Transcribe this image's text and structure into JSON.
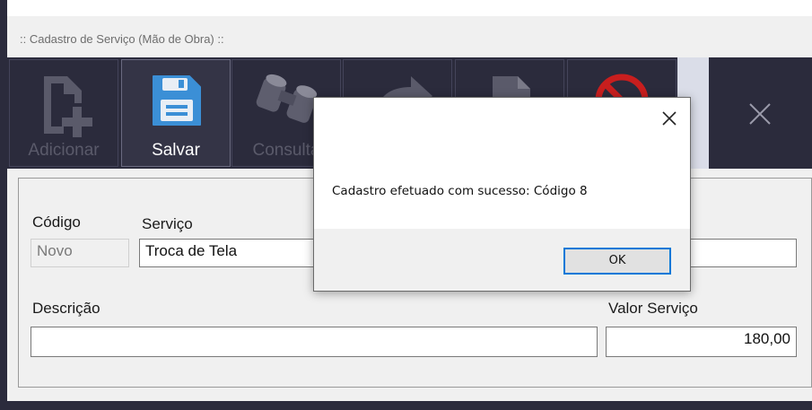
{
  "window": {
    "title": ":: Cadastro de Serviço (Mão de Obra) ::"
  },
  "toolbar": {
    "buttons": [
      {
        "label": "Adicionar",
        "icon": "file-add-icon"
      },
      {
        "label": "Salvar",
        "icon": "floppy-save-icon"
      },
      {
        "label": "Consulta",
        "icon": "binoculars-icon"
      },
      {
        "label": "",
        "icon": "redo-arrow-icon"
      },
      {
        "label": "",
        "icon": "document-icon"
      },
      {
        "label": "",
        "icon": "cancel-icon"
      }
    ],
    "close_icon": "close-icon"
  },
  "form": {
    "codigo_label": "Código",
    "codigo_value": "Novo",
    "servico_label": "Serviço",
    "servico_value": "Troca de Tela",
    "descricao_label": "Descrição",
    "descricao_value": "",
    "valor_label": "Valor Serviço",
    "valor_value": "180,00"
  },
  "dialog": {
    "message": "Cadastro efetuado com sucesso: Código 8",
    "ok_label": "OK",
    "close_icon": "close-icon"
  },
  "colors": {
    "toolbar_bg": "#2b2b3c",
    "accent_save": "#3b8fd6",
    "ok_border": "#0078d7"
  }
}
